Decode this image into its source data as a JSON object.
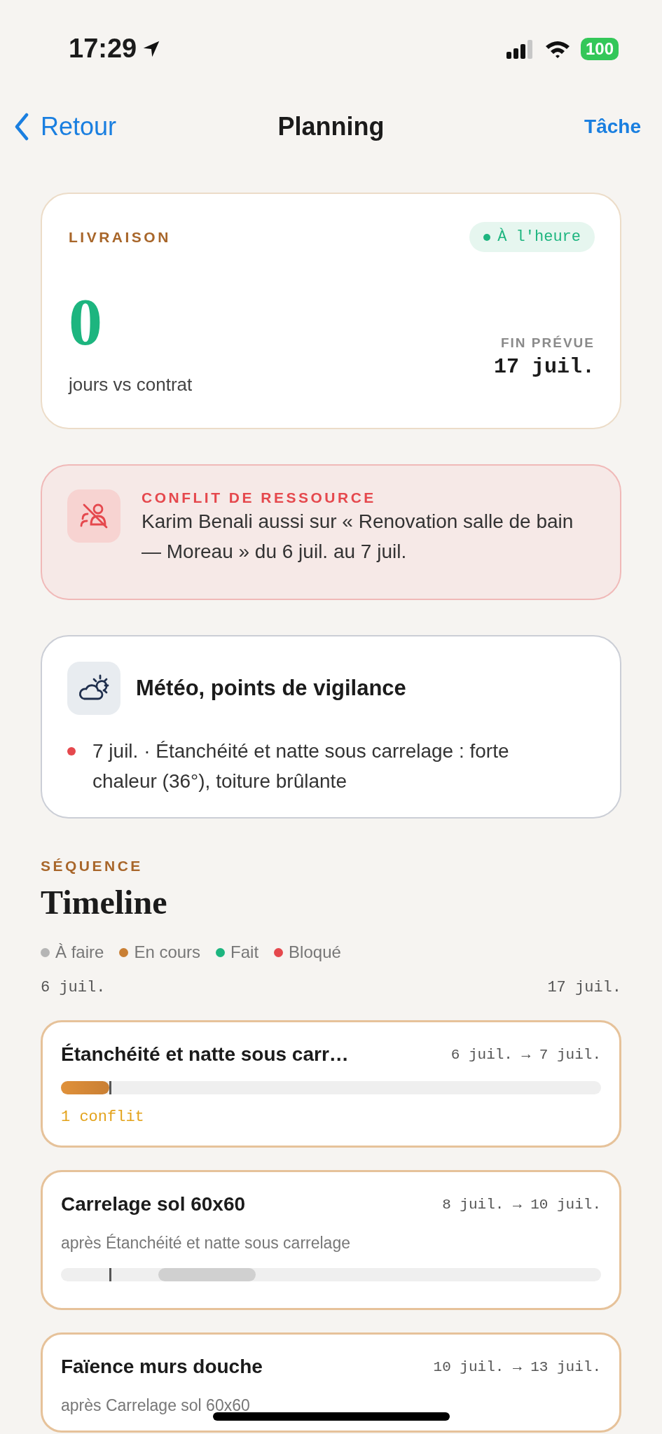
{
  "status_bar": {
    "time": "17:29",
    "battery": "100"
  },
  "nav": {
    "back": "Retour",
    "title": "Planning",
    "action": "Tâche"
  },
  "delivery": {
    "label": "LIVRAISON",
    "badge": "À l'heure",
    "value": "0",
    "caption": "jours vs contrat",
    "end_label": "FIN PRÉVUE",
    "end_date": "17 juil."
  },
  "conflict": {
    "title": "CONFLIT DE RESSOURCE",
    "text": "Karim Benali aussi sur « Renovation salle de bain — Moreau » du 6 juil. au 7 juil."
  },
  "weather": {
    "title": "Météo, points de vigilance",
    "alerts": [
      {
        "text": "7 juil. · Étanchéité et natte sous carrelage : forte chaleur (36°), toiture brûlante",
        "color": "#e5484d"
      }
    ]
  },
  "timeline": {
    "eyebrow": "SÉQUENCE",
    "title": "Timeline",
    "legend": [
      {
        "label": "À faire",
        "color": "#b5b5b5"
      },
      {
        "label": "En cours",
        "color": "#c97f34"
      },
      {
        "label": "Fait",
        "color": "#1db57f"
      },
      {
        "label": "Bloqué",
        "color": "#e5484d"
      }
    ],
    "start": "6 juil.",
    "end": "17 juil.",
    "today": {
      "level": 0.09
    },
    "tasks": [
      {
        "title": "Étanchéité et natte sous carr…",
        "dates": "6 juil. → 7 juil.",
        "kind": "in_progress",
        "bar": {
          "level": 0.09
        },
        "conflict": "1 conflit"
      },
      {
        "title": "Carrelage sol 60x60",
        "dates": "8 juil. → 10 juil.",
        "after": "après Étanchéité et natte sous carrelage",
        "kind": "todo",
        "bar": {
          "level": 0.18
        }
      },
      {
        "title": "Faïence murs douche",
        "dates": "10 juil. → 13 juil.",
        "after": "après Carrelage sol 60x60"
      }
    ]
  }
}
